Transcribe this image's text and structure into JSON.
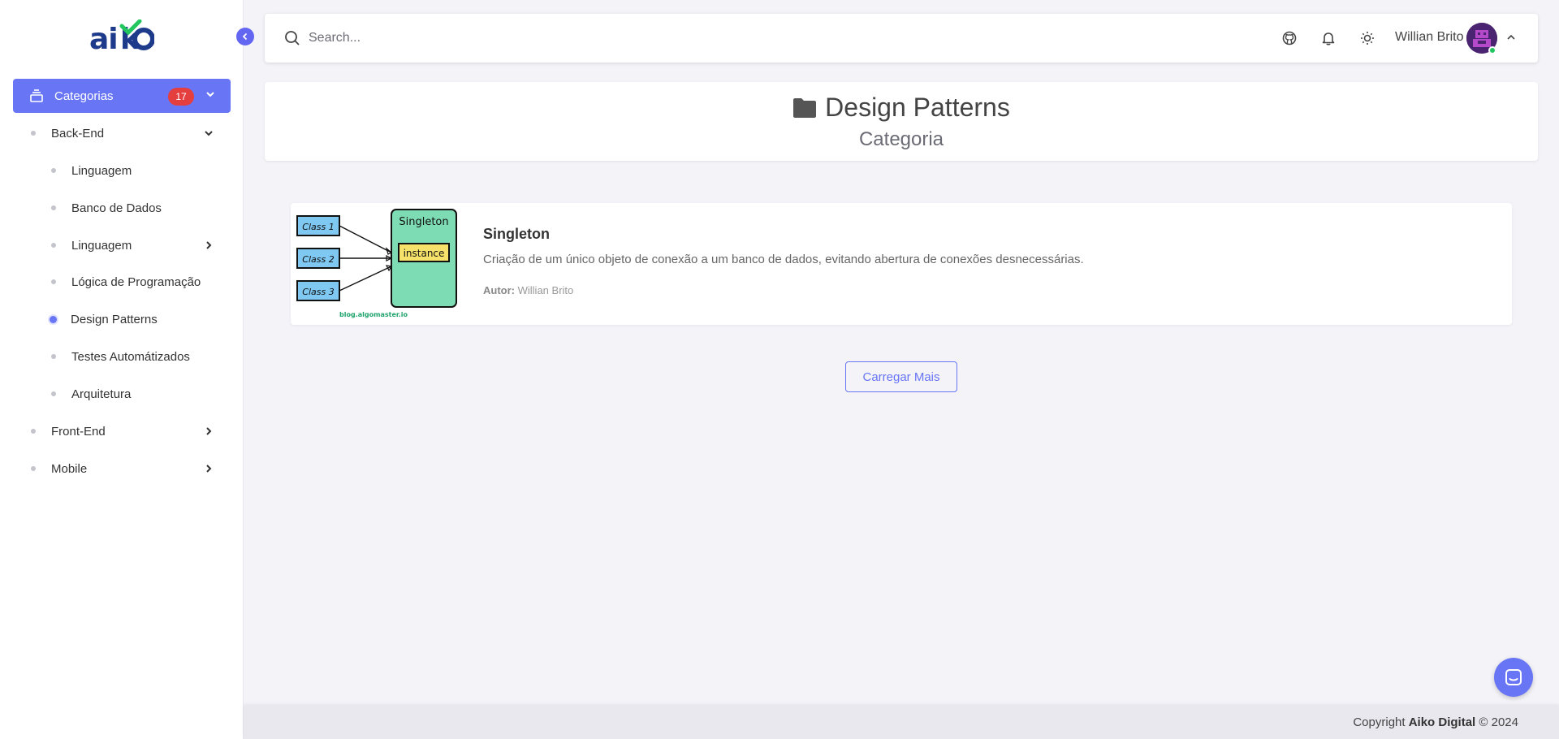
{
  "sidebar": {
    "logo_text": "aiko",
    "categories_label": "Categorias",
    "categories_count": "17",
    "items": [
      {
        "label": "Back-End",
        "level": 1,
        "chevron": "down"
      },
      {
        "label": "Linguagem",
        "level": 2
      },
      {
        "label": "Banco de Dados",
        "level": 2
      },
      {
        "label": "Linguagem",
        "level": 2,
        "chevron": "right"
      },
      {
        "label": "Lógica de Programação",
        "level": 2
      },
      {
        "label": "Design Patterns",
        "level": 2,
        "active": true
      },
      {
        "label": "Testes Automátizados",
        "level": 2
      },
      {
        "label": "Arquitetura",
        "level": 2
      },
      {
        "label": "Front-End",
        "level": 1,
        "chevron": "right"
      },
      {
        "label": "Mobile",
        "level": 1,
        "chevron": "right"
      }
    ]
  },
  "topbar": {
    "search_placeholder": "Search...",
    "icons": [
      "github-icon",
      "bell-icon",
      "sun-icon"
    ],
    "username": "Willian Brito"
  },
  "page": {
    "title": "Design Patterns",
    "subtitle": "Categoria"
  },
  "posts": [
    {
      "title": "Singleton",
      "description": "Criação de um único objeto de conexão a um banco de dados, evitando abertura de conexões desnecessárias.",
      "author_label": "Autor:",
      "author": "Willian Brito",
      "thumb": {
        "class1": "Class 1",
        "class2": "Class 2",
        "class3": "Class 3",
        "singleton": "Singleton",
        "instance": "instance",
        "source": "blog.algomaster.io"
      }
    }
  ],
  "load_more_label": "Carregar Mais",
  "footer": {
    "prefix": "Copyright",
    "company": "Aiko Digital",
    "suffix": "© 2024"
  },
  "colors": {
    "accent": "#6875f5",
    "badge": "#e53e3e",
    "online": "#22c55e"
  }
}
